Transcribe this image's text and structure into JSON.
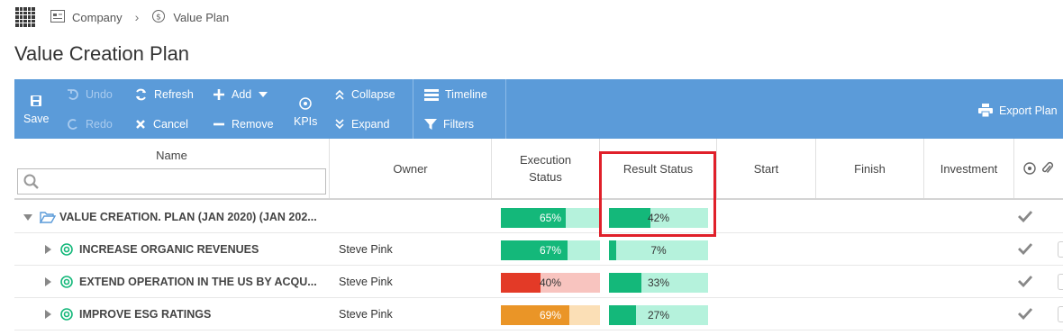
{
  "breadcrumb": {
    "company": "Company",
    "plan": "Value Plan"
  },
  "page_title": "Value Creation Plan",
  "toolbar": {
    "save": "Save",
    "undo": "Undo",
    "redo": "Redo",
    "refresh": "Refresh",
    "cancel": "Cancel",
    "add": "Add",
    "remove": "Remove",
    "kpis": "KPIs",
    "collapse": "Collapse",
    "expand": "Expand",
    "timeline": "Timeline",
    "filters": "Filters",
    "export": "Export Plan"
  },
  "columns": {
    "name": "Name",
    "owner": "Owner",
    "execution_status": "Execution Status",
    "result_status": "Result Status",
    "start": "Start",
    "finish": "Finish",
    "investment": "Investment"
  },
  "colors": {
    "toolbar": "#5b9bd9",
    "green": "#14b87a",
    "green_light": "#b5f2dc",
    "red": "#e33a27",
    "red_light": "#f8c4bf",
    "orange": "#ea9527",
    "orange_light": "#fbdfb6",
    "highlight": "#e0202a"
  },
  "rows": [
    {
      "name": "VALUE CREATION. PLAN (JAN 2020) (JAN 202...",
      "owner": "",
      "execution": {
        "label": "65%",
        "value": 0.65,
        "color": "green"
      },
      "result": {
        "label": "42%",
        "value": 0.42,
        "color": "green"
      }
    },
    {
      "name": "INCREASE ORGANIC REVENUES",
      "owner": "Steve Pink",
      "execution": {
        "label": "67%",
        "value": 0.67,
        "color": "green"
      },
      "result": {
        "label": "7%",
        "value": 0.07,
        "color": "green"
      }
    },
    {
      "name": "EXTEND OPERATION IN THE US BY ACQU...",
      "owner": "Steve Pink",
      "execution": {
        "label": "40%",
        "value": 0.4,
        "color": "red"
      },
      "result": {
        "label": "33%",
        "value": 0.33,
        "color": "green"
      }
    },
    {
      "name": "IMPROVE ESG RATINGS",
      "owner": "Steve Pink",
      "execution": {
        "label": "69%",
        "value": 0.69,
        "color": "orange"
      },
      "result": {
        "label": "27%",
        "value": 0.27,
        "color": "green"
      }
    }
  ]
}
